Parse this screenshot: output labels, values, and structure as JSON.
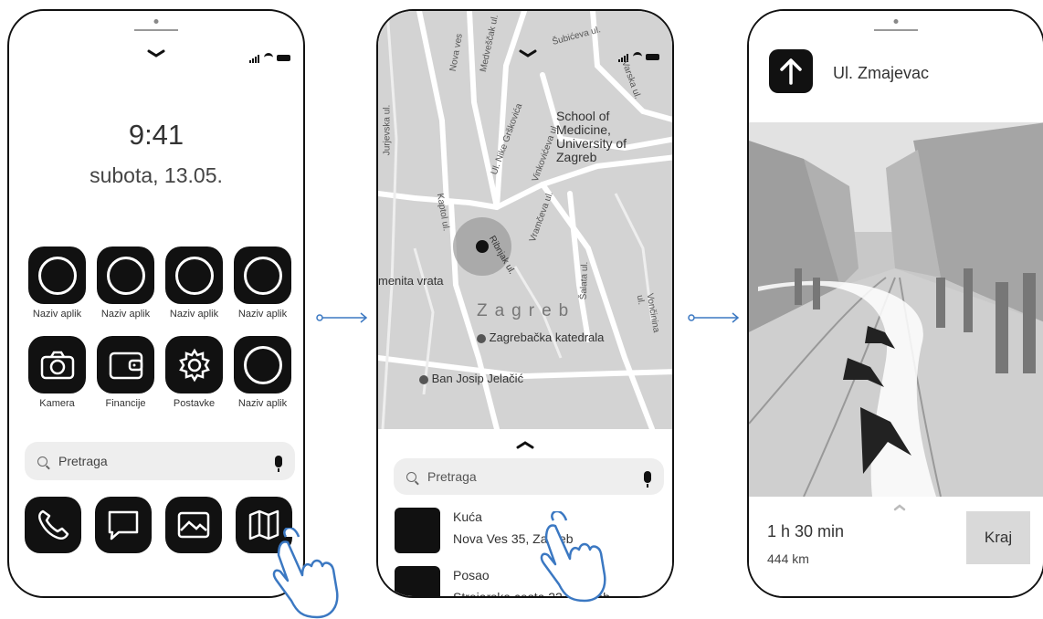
{
  "home": {
    "time": "9:41",
    "date": "subota, 13.05.",
    "apps": [
      {
        "label": "Naziv aplik",
        "icon": "circle-icon"
      },
      {
        "label": "Naziv aplik",
        "icon": "circle-icon"
      },
      {
        "label": "Naziv aplik",
        "icon": "circle-icon"
      },
      {
        "label": "Naziv aplik",
        "icon": "circle-icon"
      },
      {
        "label": "Kamera",
        "icon": "camera-icon"
      },
      {
        "label": "Financije",
        "icon": "wallet-icon"
      },
      {
        "label": "Postavke",
        "icon": "gear-icon"
      },
      {
        "label": "Naziv aplik",
        "icon": "circle-icon"
      }
    ],
    "search_placeholder": "Pretraga",
    "dock": [
      "phone-icon",
      "message-icon",
      "gallery-icon",
      "map-icon"
    ]
  },
  "map_screen": {
    "labels": {
      "medicine": "School of Medicine, University of Zagreb",
      "menita": "menita vrata",
      "zagreb": "Zagreb",
      "katedrala": "Zagrebačka katedrala",
      "ban": "Ban Josip Jelačić",
      "kaptol": "Kaptol ul.",
      "ribnjak": "Ribnjak ul.",
      "nova_ves": "Nova ves",
      "medvescak": "Medveščak ul.",
      "niko": "Ul. Nike Grškovića",
      "vinkoviceva": "Vinkovićeva ul.",
      "vramceva": "Vramčeva ul.",
      "salata": "Šalata ul.",
      "voncinina": "Vončinina ul.",
      "jurjevska": "Jurjevska ul.",
      "strossmayer": "Šubićeva ul.",
      "varska": "Varska ul."
    },
    "search_placeholder": "Pretraga",
    "places": [
      {
        "name": "Kuća",
        "address": "Nova Ves 35, Zagreb"
      },
      {
        "name": "Posao",
        "address": "Strojarska cesta 22, Zagreb"
      }
    ]
  },
  "navigation": {
    "street": "Ul. Zmajevac",
    "eta": "1 h 30 min",
    "distance": "444 km",
    "end_label": "Kraj"
  }
}
